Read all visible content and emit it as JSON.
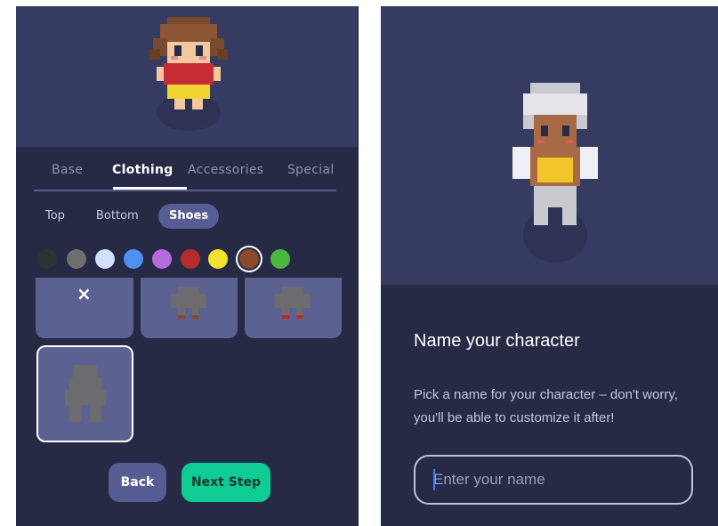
{
  "left_panel": {
    "tabs": [
      {
        "label": "Base"
      },
      {
        "label": "Clothing"
      },
      {
        "label": "Accessories"
      },
      {
        "label": "Special"
      }
    ],
    "active_tab": "Clothing",
    "subtabs": [
      {
        "label": "Top"
      },
      {
        "label": "Bottom"
      },
      {
        "label": "Shoes"
      }
    ],
    "active_subtab": "Shoes",
    "swatches": [
      {
        "color": "#2c3434"
      },
      {
        "color": "#6e6e6e"
      },
      {
        "color": "#d2e0fc"
      },
      {
        "color": "#5090f2"
      },
      {
        "color": "#b26cdc"
      },
      {
        "color": "#b62c2c"
      },
      {
        "color": "#f4e22c"
      },
      {
        "color": "#8a4a2c",
        "selected": true
      },
      {
        "color": "#4ab840"
      }
    ],
    "items": [
      {
        "icon": "close-icon",
        "label": "×"
      },
      {
        "icon": "character-preview-icon"
      },
      {
        "icon": "character-preview-icon"
      },
      {
        "icon": "character-preview-icon",
        "selected": true
      }
    ],
    "buttons": {
      "back": "Back",
      "next": "Next Step"
    }
  },
  "right_panel": {
    "title": "Name your character",
    "description": "Pick a name for your character – don't worry, you'll be able to customize it after!",
    "name_input": {
      "placeholder": "Enter your name",
      "value": ""
    }
  },
  "colors": {
    "panel_bg": "#262a45",
    "stage_bg": "#363b62",
    "accent_green": "#0fcc94",
    "item_bg": "#5b6190",
    "chip_active": "#575d92"
  }
}
